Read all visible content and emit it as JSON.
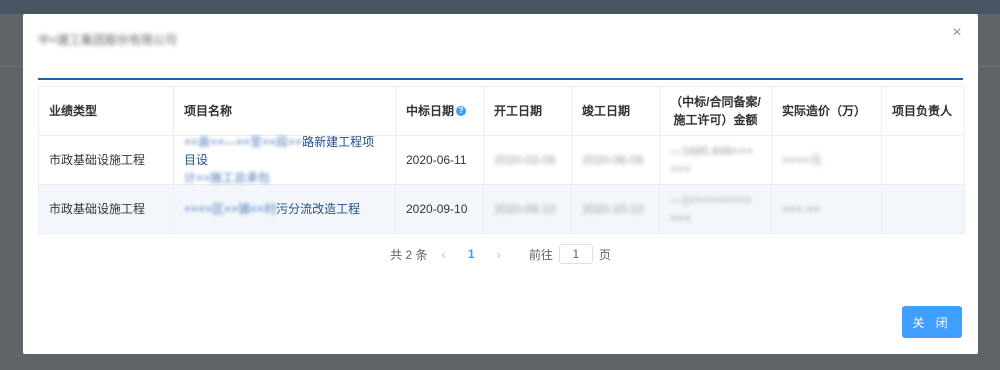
{
  "modal": {
    "title": "中×建工集团股份有限公司",
    "close_icon": "×",
    "close_button": "关 闭"
  },
  "table": {
    "headers": [
      "业绩类型",
      "项目名称",
      "中标日期",
      "开工日期",
      "竣工日期",
      "（中标/合同备案/施工许可）金额",
      "实际造价（万）",
      "项目负责人"
    ],
    "help_icon": "?",
    "rows": [
      {
        "type": "市政基础设施工程",
        "name_blurred": "××县××—××至××段××",
        "name": "路新建工程项目设",
        "name_line2": "计××施工总承包",
        "bid_date": "2020-06-11",
        "start_date": "2020-03-08",
        "end_date": "2020-06-08",
        "amount_line1": "—1685.846×××",
        "amount_line2": "×××",
        "actual_cost": "××××元",
        "manager": ""
      },
      {
        "type": "市政基础设施工程",
        "name_blurred": "××××区××镇××村",
        "name": "污分流改造工程",
        "name_line2": "",
        "bid_date": "2020-09-10",
        "start_date": "2020-09-10",
        "end_date": "2020-10-10",
        "amount_line1": "—1×××××××××",
        "amount_line2": "×××",
        "actual_cost": "×××.××",
        "manager": ""
      }
    ]
  },
  "pager": {
    "total": "共 2 条",
    "prev_icon": "‹",
    "current": "1",
    "next_icon": "›",
    "goto_label": "前往",
    "page_input": "1",
    "page_suffix": "页"
  }
}
